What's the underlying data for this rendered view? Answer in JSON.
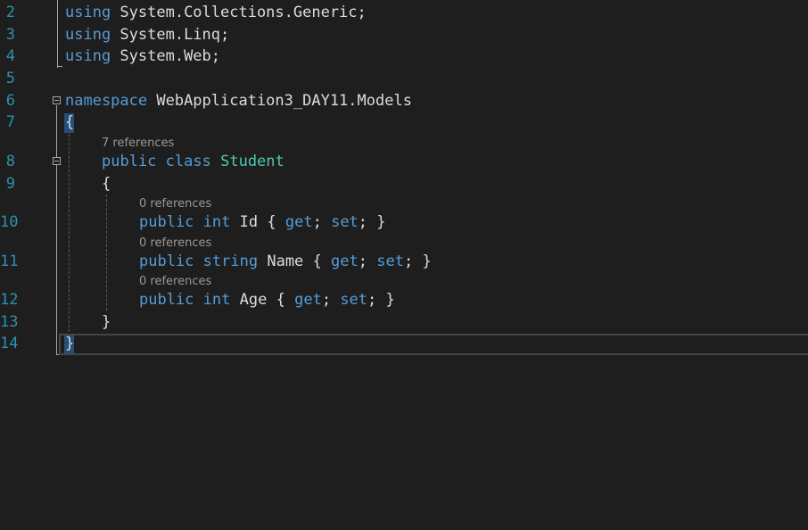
{
  "editor": {
    "line_numbers": [
      "2",
      "3",
      "4",
      "5",
      "6",
      "7",
      "8",
      "9",
      "10",
      "11",
      "12",
      "13",
      "14"
    ],
    "lines": {
      "l2": {
        "kw": "using",
        "rest": " System.Collections.Generic;"
      },
      "l3": {
        "kw": "using",
        "rest": " System.Linq;"
      },
      "l4": {
        "kw": "using",
        "rest": " System.Web;"
      },
      "l6": {
        "kw": "namespace",
        "rest": " WebApplication3_DAY11.Models"
      },
      "l7": {
        "brace": "{"
      },
      "l8": {
        "kw1": "public",
        "kw2": "class",
        "type": "Student"
      },
      "l9": {
        "brace": "{"
      },
      "l10": {
        "kw1": "public",
        "kw2": "int",
        "name": "Id",
        "open": "{",
        "get": "get",
        "set": "set",
        "close": "}"
      },
      "l11": {
        "kw1": "public",
        "kw2": "string",
        "name": "Name",
        "open": "{",
        "get": "get",
        "set": "set",
        "close": "}"
      },
      "l12": {
        "kw1": "public",
        "kw2": "int",
        "name": "Age",
        "open": "{",
        "get": "get",
        "set": "set",
        "close": "}"
      },
      "l13": {
        "brace": "}"
      },
      "l14": {
        "brace": "}"
      }
    },
    "codelens": {
      "class_refs": "7 references",
      "id_refs": "0 references",
      "name_refs": "0 references",
      "age_refs": "0 references"
    },
    "colors": {
      "background": "#1e1e1e",
      "keyword": "#569cd6",
      "type": "#4ec9b0",
      "text": "#dcdcdc",
      "line_number": "#2b91af",
      "codelens": "#999999",
      "brace_highlight": "#264f78"
    }
  }
}
